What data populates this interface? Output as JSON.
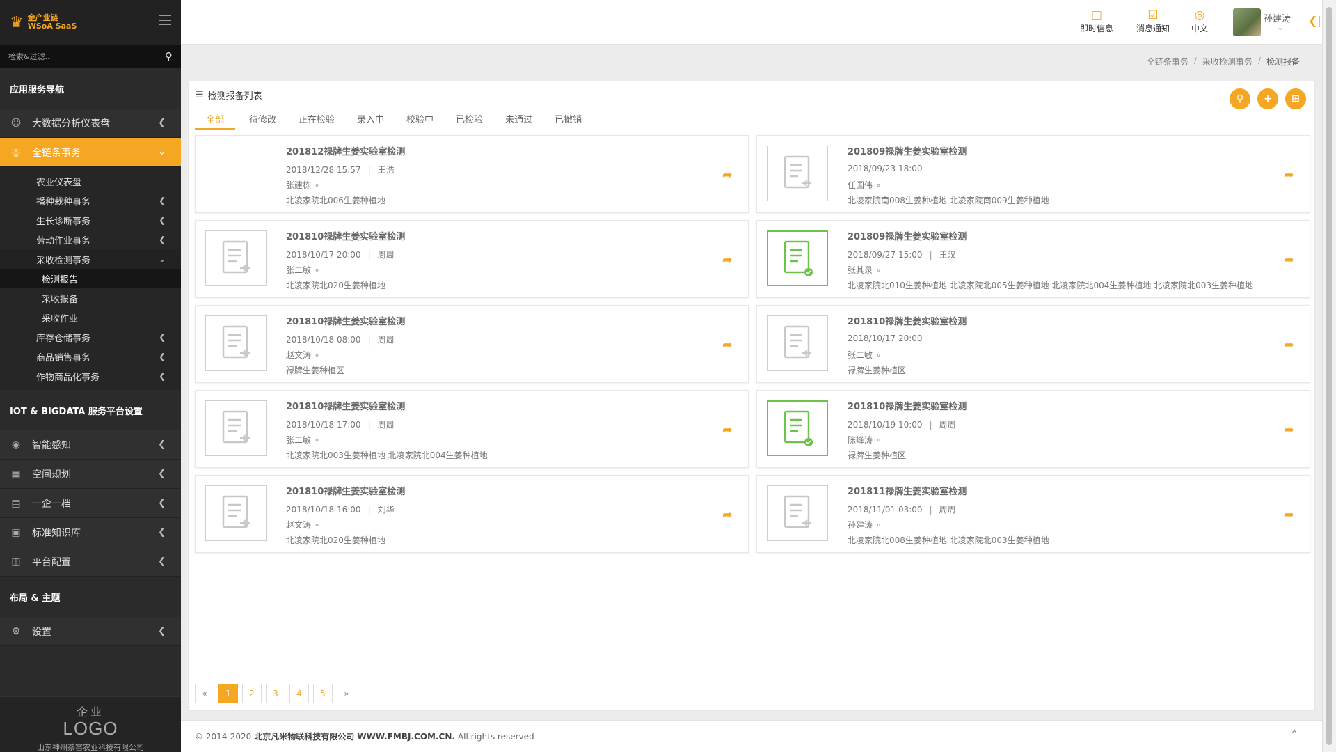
{
  "sidebar": {
    "logo_text_line1": "金产业链",
    "logo_text_line2": "WSoA SaaS",
    "search_placeholder": "检索&过滤...",
    "section_app_nav": "应用服务导航",
    "section_iot": "IOT & BIGDATA 服务平台设置",
    "section_layout": "布局 & 主题",
    "items": {
      "bigdata": "大数据分析仪表盘",
      "chain": "全链条事务",
      "sensing": "智能感知",
      "space": "空间规划",
      "enterprise": "一企一档",
      "knowledge": "标准知识库",
      "platform": "平台配置",
      "settings": "设置"
    },
    "sub_items": {
      "agri_dashboard": "农业仪表盘",
      "planting": "播种栽种事务",
      "diagnosis": "生长诊断事务",
      "labor": "劳动作业事务",
      "harvest": "采收检测事务",
      "inspection_report": "检测报告",
      "harvest_report": "采收报备",
      "harvest_work": "采收作业",
      "storage": "库存仓储事务",
      "sales": "商品销售事务",
      "commodity": "作物商品化事务"
    },
    "enterprise_logo_top": "企业",
    "enterprise_logo_bottom": "LOGO",
    "company": "山东神州萘窖农业科技有限公司"
  },
  "topbar": {
    "instant_msg": "即时信息",
    "notifications": "消息通知",
    "language": "中文",
    "username": "孙建涛"
  },
  "breadcrumb": [
    "全链条事务",
    "采收检测事务",
    "检测报备"
  ],
  "panel": {
    "title": "检测报备列表",
    "tabs": [
      "全部",
      "待修改",
      "正在检验",
      "录入中",
      "校验中",
      "已检验",
      "未通过",
      "已撤销"
    ]
  },
  "cards": [
    {
      "title": "201812禄牌生姜实验室检测",
      "datetime": "2018/12/28 15:57",
      "assignee": "王浩",
      "person": "张建栋",
      "locations": "北凌家院北006生姜种植地",
      "status_icon": "none"
    },
    {
      "title": "201809禄牌生姜实验室检测",
      "datetime": "2018/09/23 18:00",
      "assignee": "",
      "person": "任国伟",
      "locations": "北凌家院南008生姜种植地 北凌家院南009生姜种植地",
      "status_icon": "pending"
    },
    {
      "title": "201810禄牌生姜实验室检测",
      "datetime": "2018/10/17 20:00",
      "assignee": "周周",
      "person": "张二敏",
      "locations": "北凌家院北020生姜种植地",
      "status_icon": "pending"
    },
    {
      "title": "201809禄牌生姜实验室检测",
      "datetime": "2018/09/27 15:00",
      "assignee": "王汉",
      "person": "张其录",
      "locations": "北凌家院北010生姜种植地 北凌家院北005生姜种植地 北凌家院北004生姜种植地 北凌家院北003生姜种植地",
      "status_icon": "passed"
    },
    {
      "title": "201810禄牌生姜实验室检测",
      "datetime": "2018/10/18 08:00",
      "assignee": "周周",
      "person": "赵文涛",
      "locations": "禄牌生姜种植区",
      "status_icon": "pending"
    },
    {
      "title": "201810禄牌生姜实验室检测",
      "datetime": "2018/10/17 20:00",
      "assignee": "",
      "person": "张二敏",
      "locations": "禄牌生姜种植区",
      "status_icon": "pending"
    },
    {
      "title": "201810禄牌生姜实验室检测",
      "datetime": "2018/10/18 17:00",
      "assignee": "周周",
      "person": "张二敏",
      "locations": "北凌家院北003生姜种植地 北凌家院北004生姜种植地",
      "status_icon": "pending"
    },
    {
      "title": "201810禄牌生姜实验室检测",
      "datetime": "2018/10/19 10:00",
      "assignee": "周周",
      "person": "陈峰涛",
      "locations": "禄牌生姜种植区",
      "status_icon": "passed"
    },
    {
      "title": "201810禄牌生姜实验室检测",
      "datetime": "2018/10/18 16:00",
      "assignee": "刘华",
      "person": "赵文涛",
      "locations": "北凌家院北020生姜种植地",
      "status_icon": "pending"
    },
    {
      "title": "201811禄牌生姜实验室检测",
      "datetime": "2018/11/01 03:00",
      "assignee": "周周",
      "person": "孙建涛",
      "locations": "北凌家院北008生姜种植地 北凌家院北003生姜种植地",
      "status_icon": "pending"
    }
  ],
  "pagination": {
    "prev": "«",
    "pages": [
      "1",
      "2",
      "3",
      "4",
      "5"
    ],
    "next": "»",
    "current": "1"
  },
  "footer": {
    "copyright": "© 2014-2020",
    "company": "北京凡米物联科技有限公司 WWW.FMBJ.COM.CN.",
    "rights": "All rights reserved"
  },
  "colors": {
    "accent": "#f5a623",
    "sidebar": "#2b2b2b",
    "passed": "#6cc24a"
  }
}
